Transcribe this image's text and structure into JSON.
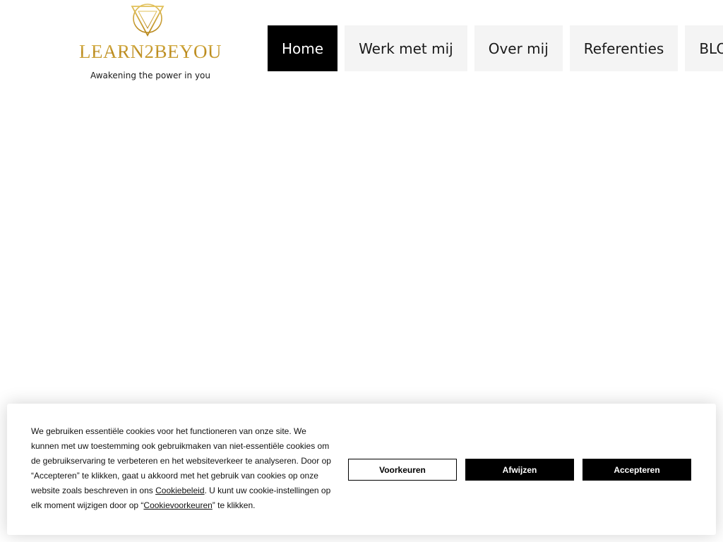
{
  "brand": {
    "name": "LEARN2BEYOU",
    "tagline": "Awakening the power in you",
    "gold": "#c9a227"
  },
  "nav": {
    "items": [
      {
        "label": "Home",
        "active": true
      },
      {
        "label": "Werk met mij",
        "active": false
      },
      {
        "label": "Over mij",
        "active": false
      },
      {
        "label": "Referenties",
        "active": false
      },
      {
        "label": "BLOG",
        "active": false
      }
    ]
  },
  "cookie": {
    "text_part1": "We gebruiken essentiële cookies voor het functioneren van onze site. We kunnen met uw toestemming ook gebruikmaken van niet-essentiële cookies om de gebruikservaring te verbeteren en het websiteverkeer te analyseren. Door op “Accepteren” te klikken, gaat u akkoord met het gebruik van cookies op onze website zoals beschreven in ons ",
    "policy_link": "Cookiebeleid",
    "text_part2": ". U kunt uw cookie-instellingen op elk moment wijzigen door op “",
    "prefs_link": "Cookievoorkeuren",
    "text_part3": "” te klikken.",
    "buttons": {
      "preferences": "Voorkeuren",
      "reject": "Afwijzen",
      "accept": "Accepteren"
    }
  }
}
